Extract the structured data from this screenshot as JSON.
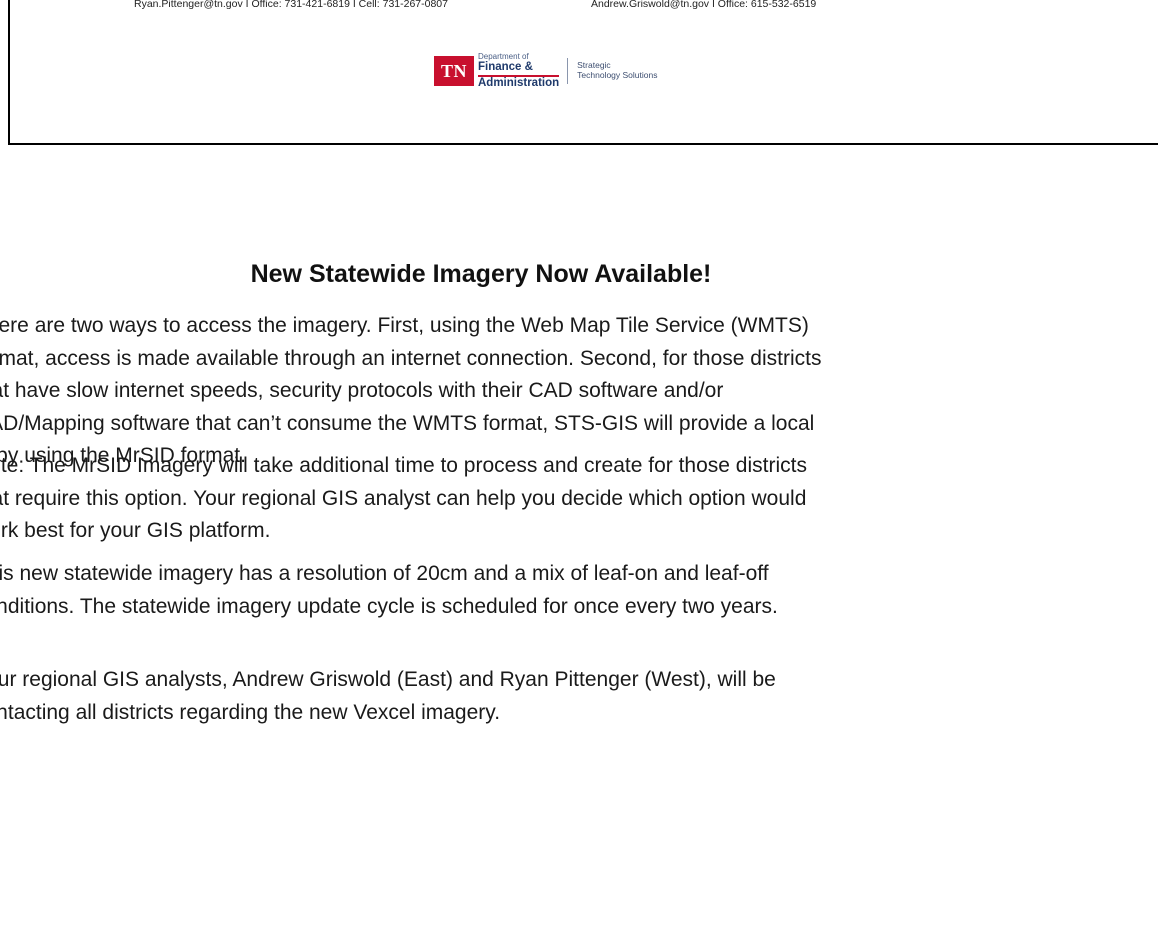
{
  "header": {
    "contact_west": "Ryan.Pittenger@tn.gov I Office: 731-421-6819 I Cell: 731-267-0807",
    "contact_east": "Andrew.Griswold@tn.gov I Office: 615-532-6519",
    "logo": {
      "badge": "TN",
      "dept_line1": "Department of",
      "dept_line2": "Finance &",
      "dept_line3": "Administration",
      "unit_line1": "Strategic",
      "unit_line2": "Technology Solutions"
    }
  },
  "article": {
    "headline": "New Statewide Imagery Now Available!",
    "paragraphs": [
      {
        "lines": [
          "There are two ways to access the imagery. First, using the Web Map Tile Service (WMTS)",
          "format, access is made available through an internet connection. Second, for those districts",
          "that have slow internet speeds, security protocols with their CAD software and/or",
          "CAD/Mapping software that can’t consume the WMTS format, STS-GIS will provide a local",
          "copy using the MrSID format."
        ]
      },
      {
        "lines": [
          "Note: The MrSID Imagery will take additional time to process and create for those districts",
          "that require this option. Your regional GIS analyst can help you decide which option would",
          "work best for your GIS platform."
        ]
      },
      {
        "lines": [
          "This new statewide imagery has a resolution of 20cm and a mix of leaf-on and leaf-off",
          "conditions. The statewide imagery update cycle is scheduled for once every two years."
        ]
      },
      {
        "lines": [
          "Your regional GIS analysts, Andrew Griswold (East) and Ryan Pittenger (West), will be",
          "contacting all districts regarding the new Vexcel imagery."
        ]
      }
    ]
  }
}
